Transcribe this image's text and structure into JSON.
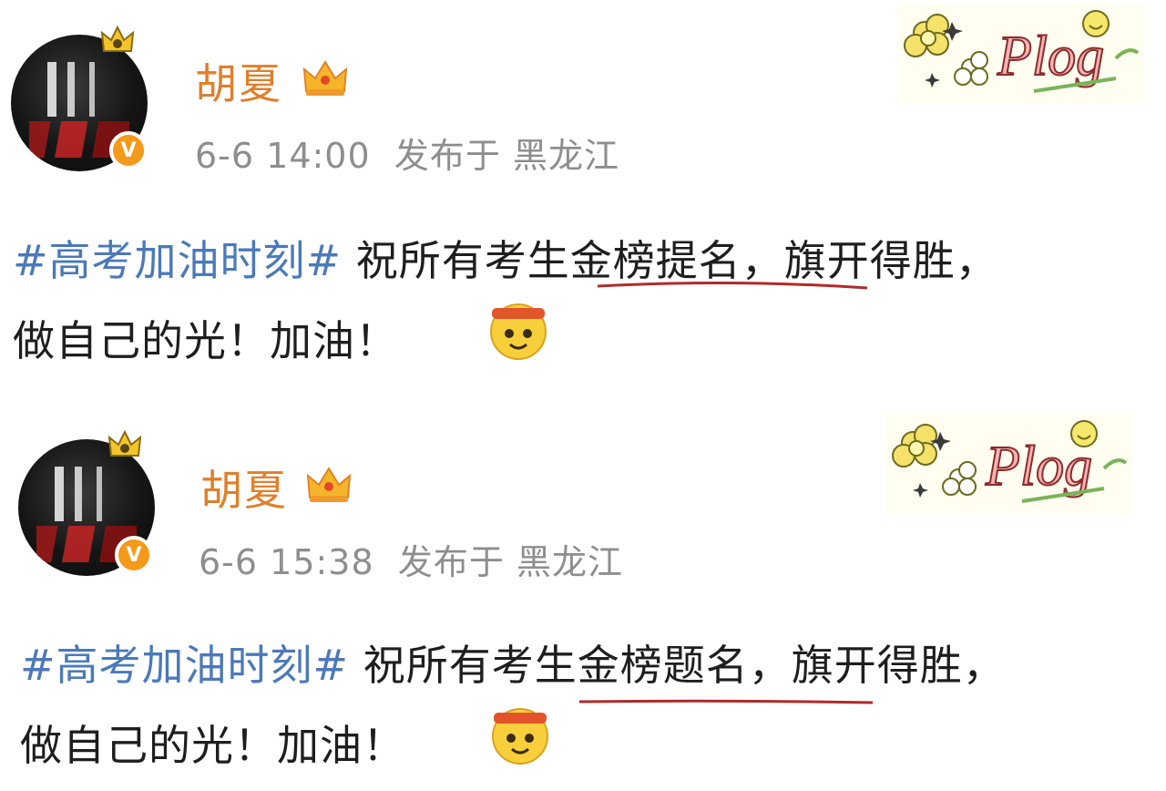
{
  "posts": [
    {
      "username": "胡夏",
      "time": "6-6 14:00",
      "location_prefix": "发布于",
      "location": "黑龙江",
      "hashtag": "#高考加油时刻#",
      "line1_rest": "祝所有考生金榜提名，旗开得胜，",
      "line2": "做自己的光！加油！",
      "sticker_text": "Plog",
      "icons": [
        "avatar",
        "verified-badge-icon",
        "crown-icon",
        "plog-sticker",
        "cheer-emoji-icon"
      ]
    },
    {
      "username": "胡夏",
      "time": "6-6 15:38",
      "location_prefix": "发布于",
      "location": "黑龙江",
      "hashtag": "#高考加油时刻#",
      "line1_rest": "祝所有考生金榜题名，旗开得胜，",
      "line2": "做自己的光！加油！",
      "sticker_text": "Plog",
      "icons": [
        "avatar",
        "verified-badge-icon",
        "crown-icon",
        "plog-sticker",
        "cheer-emoji-icon"
      ]
    }
  ],
  "colors": {
    "username": "#e07f2b",
    "hashtag": "#4b79b9",
    "meta": "#8e8e8e",
    "body_text": "#1e1e1e",
    "underline": "#b02a2a",
    "verify_badge": "#f39a1b"
  }
}
